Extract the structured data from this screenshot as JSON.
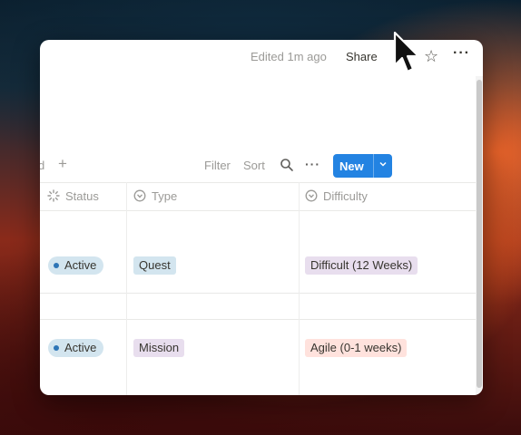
{
  "topbar": {
    "edited": "Edited 1m ago",
    "share": "Share",
    "star_icon": "star-icon",
    "more_icon": "more-horizontal-icon"
  },
  "toolbar": {
    "view_fragment": "d",
    "add_view": "+",
    "filter": "Filter",
    "sort": "Sort",
    "search_icon": "search-icon",
    "more_icon": "more-horizontal-icon",
    "new_label": "New",
    "new_chevron": "chevron-down-icon",
    "accent_color": "#2383e2"
  },
  "table": {
    "columns": [
      {
        "label": "Status",
        "icon": "status-icon"
      },
      {
        "label": "Type",
        "icon": "select-icon"
      },
      {
        "label": "Difficulty",
        "icon": "select-icon"
      }
    ],
    "rows": [
      {
        "status": "Active",
        "type": "Quest",
        "difficulty": "Difficult (12 Weeks)"
      },
      {
        "status": "Active",
        "type": "Mission",
        "difficulty": "Agile (0-1 weeks)"
      }
    ]
  },
  "colors": {
    "status_pill": "#d3e5ef",
    "quest_pill": "#d3e5ef",
    "mission_pill": "#e8deee",
    "difficult_pill": "#e8deee",
    "agile_pill": "#ffe2dd"
  }
}
